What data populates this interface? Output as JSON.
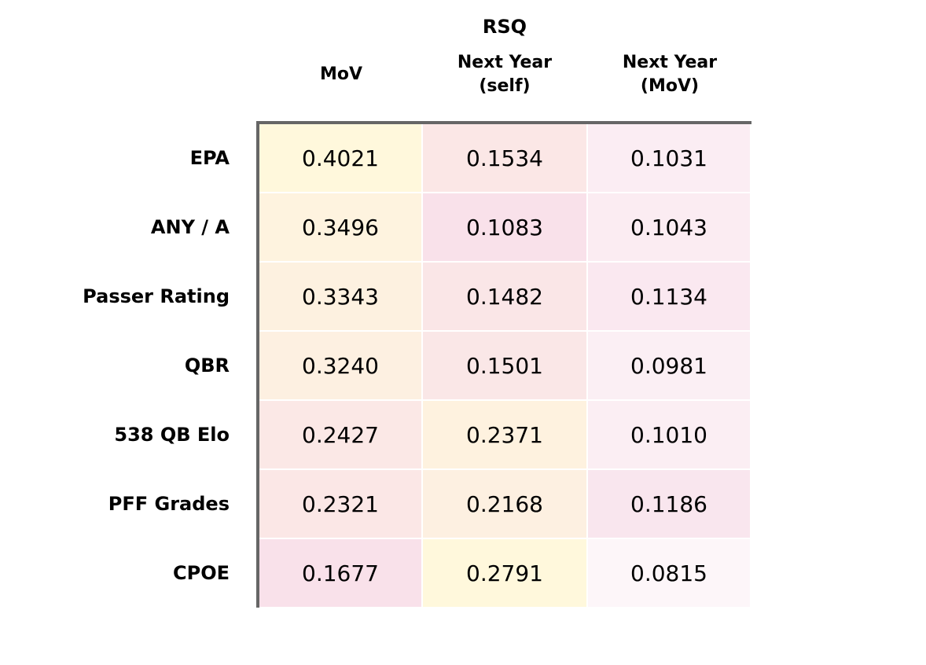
{
  "chart_data": {
    "type": "heatmap",
    "title": "RSQ",
    "columns": [
      "MoV",
      "Next Year\n(self)",
      "Next Year\n(MoV)"
    ],
    "rows": [
      "EPA",
      "ANY / A",
      "Passer Rating",
      "QBR",
      "538 QB Elo",
      "PFF Grades",
      "CPOE"
    ],
    "values": [
      [
        "0.4021",
        "0.1534",
        "0.1031"
      ],
      [
        "0.3496",
        "0.1083",
        "0.1043"
      ],
      [
        "0.3343",
        "0.1482",
        "0.1134"
      ],
      [
        "0.3240",
        "0.1501",
        "0.0981"
      ],
      [
        "0.2427",
        "0.2371",
        "0.1010"
      ],
      [
        "0.2321",
        "0.2168",
        "0.1186"
      ],
      [
        "0.1677",
        "0.2791",
        "0.0815"
      ]
    ],
    "color_scale": {
      "low": "#f9e1ea",
      "high": "#fff8dc",
      "neutral": "#fdf5f8"
    }
  }
}
